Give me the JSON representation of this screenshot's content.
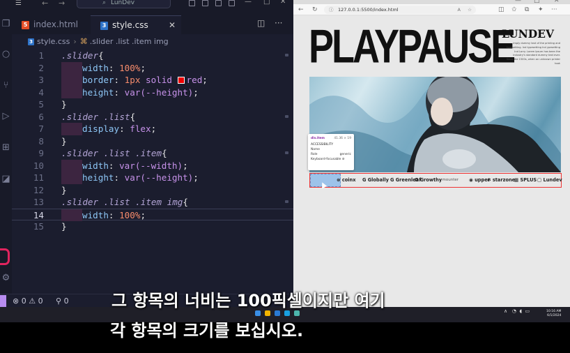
{
  "vscode": {
    "search": "LunDev",
    "tabs": [
      {
        "label": "index.html",
        "icon": "html-file-icon"
      },
      {
        "label": "style.css",
        "icon": "css-file-icon",
        "active": true
      }
    ],
    "breadcrumb": {
      "file": "style.css",
      "selector": ".slider .list .item img"
    },
    "code": [
      {
        "n": "1",
        "sel": ".slider",
        "open": "{"
      },
      {
        "n": "2",
        "prop": "width",
        "val": "100%",
        "valtype": "num"
      },
      {
        "n": "3",
        "prop": "border",
        "num": "1px",
        "kw": "solid",
        "color": "red"
      },
      {
        "n": "4",
        "prop": "height",
        "fn": "var(--height)"
      },
      {
        "n": "5",
        "close": "}"
      },
      {
        "n": "6",
        "sel": ".slider .list",
        "open": "{"
      },
      {
        "n": "7",
        "prop": "display",
        "kw": "flex"
      },
      {
        "n": "8",
        "close": "}"
      },
      {
        "n": "9",
        "sel": ".slider .list .item",
        "open": "{"
      },
      {
        "n": "10",
        "prop": "width",
        "fn": "var(--width)"
      },
      {
        "n": "11",
        "prop": "height",
        "fn": "var(--height)"
      },
      {
        "n": "12",
        "close": "}"
      },
      {
        "n": "13",
        "sel": ".slider .list .item img",
        "open": "{"
      },
      {
        "n": "14",
        "prop": "width",
        "val": "100%",
        "valtype": "num"
      },
      {
        "n": "15",
        "close": "}"
      }
    ],
    "status": {
      "errors": "0",
      "warnings": "0",
      "ports": "0"
    }
  },
  "browser": {
    "url": "127.0.0.1:5500/index.html",
    "page": {
      "title": "PLAYPAUSE",
      "brand": "LUNDEV",
      "description": "imply dummy text of the printing and typesetting. Ind typesetting Ind ypesetting Ind Lorry. Lorem Ipsum has been the industry's standard dummy text ever. Since the 1500s, when an unknown printer took",
      "logos": [
        "coinx",
        "Globally",
        "Greenleaf",
        "Growthy",
        "mounter",
        "upper",
        "starzone",
        "SPLUS",
        "Lundev"
      ]
    },
    "tooltip": {
      "title": "div.item",
      "dims": "41.36 × 19",
      "section": "ACCESSIBILITY",
      "name_label": "Name",
      "role_label": "Role",
      "role_value": "generic",
      "focus_label": "Keyboard-focusable"
    }
  },
  "taskbar": {
    "time": "10:16 AM",
    "date": "6/1/2024"
  },
  "subtitles": [
    "그 항목의 너비는 100픽셀이지만 여기",
    "각 항목의 크기를 보십시오."
  ]
}
